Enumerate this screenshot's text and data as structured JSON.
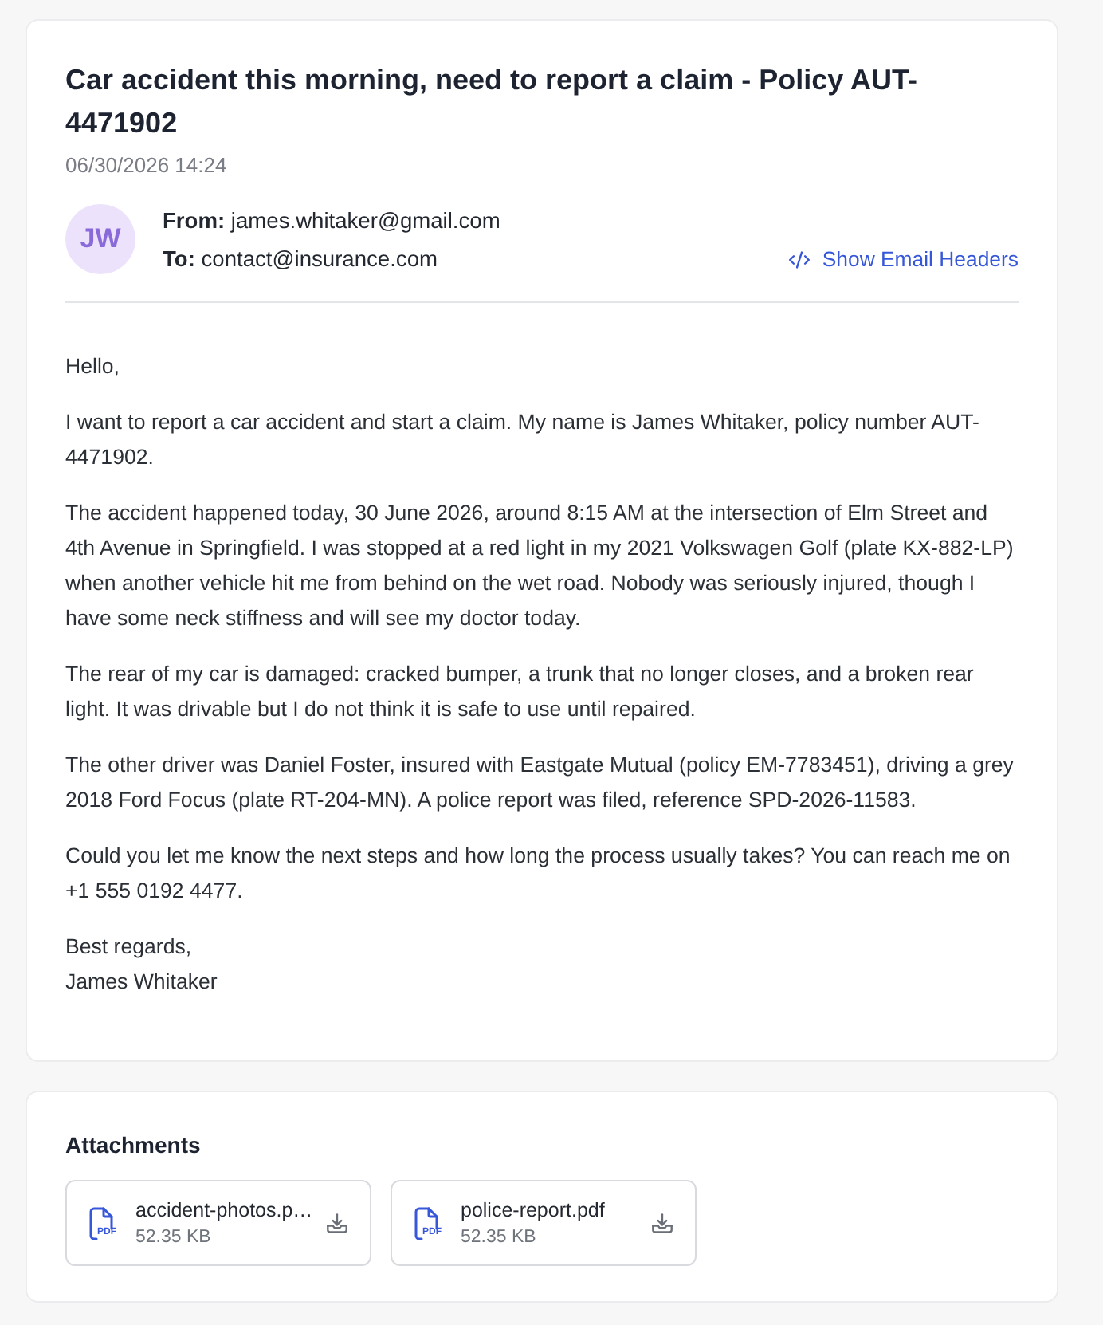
{
  "email": {
    "subject": "Car accident this morning, need to report a claim - Policy AUT-4471902",
    "date": "06/30/2026 14:24",
    "avatar": {
      "initials": "JW"
    },
    "from": "**From:** james.whitaker@gmail.com",
    "to": "**To:** contact@insurance.com",
    "headers_link": "Show Email Headers",
    "body": [
      "Hello,",
      "I want to report a car accident and start a claim. My name is James Whitaker, policy number AUT-4471902.",
      "The accident happened today, 30 June 2026, around 8:15 AM at the intersection of Elm Street and 4th Avenue in Springfield. I was stopped at a red light in my 2021 Volkswagen Golf (plate KX-882-LP) when another vehicle hit me from behind on the wet road. Nobody was seriously injured, though I have some neck stiffness and will see my doctor today.",
      "The rear of my car is damaged: cracked bumper, a trunk that no longer closes, and a broken rear light. It was drivable but I do not think it is safe to use until repaired.",
      "The other driver was Daniel Foster, insured with Eastgate Mutual (policy EM-7783451), driving a grey 2018 Ford Focus (plate RT-204-MN). A police report was filed, reference SPD-2026-11583.",
      "Could you let me know the next steps and how long the process usually takes? You can reach me on +1 555 0192 4477.",
      "Best regards,\nJames Whitaker"
    ]
  },
  "attachments": {
    "title": "Attachments",
    "files": [
      {
        "name": "accident-photos.p…",
        "type": "PDF",
        "size": "52.35 KB"
      },
      {
        "name": "police-report.pdf",
        "type": "PDF",
        "size": "52.35 KB"
      }
    ]
  }
}
